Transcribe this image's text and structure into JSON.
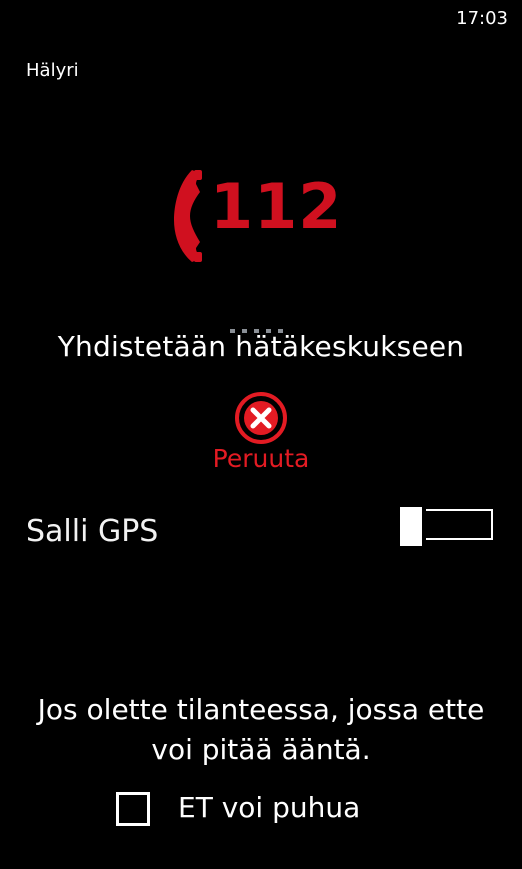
{
  "status_bar": {
    "time": "17:03"
  },
  "app": {
    "title": "Hälyri"
  },
  "logo": {
    "icon": "phone-handset-icon",
    "number": "112",
    "color": "#d0101f"
  },
  "connecting": {
    "text": "Yhdistetään hätäkeskukseen"
  },
  "cancel": {
    "label": "Peruuta",
    "icon": "close-circle-icon",
    "color": "#e31b23"
  },
  "gps": {
    "label": "Salli GPS",
    "enabled": false
  },
  "info": {
    "line1": "Jos olette tilanteessa, jossa ette",
    "line2": "voi pitää ääntä."
  },
  "cant_speak": {
    "label": "ET voi puhua",
    "checked": false
  }
}
